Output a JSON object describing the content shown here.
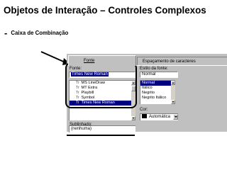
{
  "slide": {
    "title": "Objetos de Interação – Controles Complexos",
    "bullet_dash": "-",
    "subtitle": "Caixa de Combinação"
  },
  "dialog": {
    "tabs": [
      "Fonte",
      "Espaçamento de caracteres"
    ],
    "font_label": "Fonte:",
    "font_value": "Times New Roman",
    "font_list": [
      {
        "name": "MS LineDraw",
        "selected": false
      },
      {
        "name": "MT Extra",
        "selected": false
      },
      {
        "name": "Playbill",
        "selected": false
      },
      {
        "name": "Symbol",
        "selected": false
      },
      {
        "name": "Times New Roman",
        "selected": true
      }
    ],
    "truetype_glyph": "Tr",
    "style_label": "Estilo da fonte:",
    "style_value": "Normal",
    "style_list": [
      {
        "name": "Normal",
        "selected": true
      },
      {
        "name": "Itálico",
        "selected": false
      },
      {
        "name": "Negrito",
        "selected": false
      },
      {
        "name": "Negrito Itálico",
        "selected": false
      }
    ],
    "underline_label": "Sublinhado:",
    "underline_value": "(nenhuma)",
    "color_label": "Cor:",
    "color_value": "Automática"
  },
  "colors": {
    "dialog_bg": "#c0c0c0",
    "selection": "#000080",
    "annotation": "#000000"
  }
}
